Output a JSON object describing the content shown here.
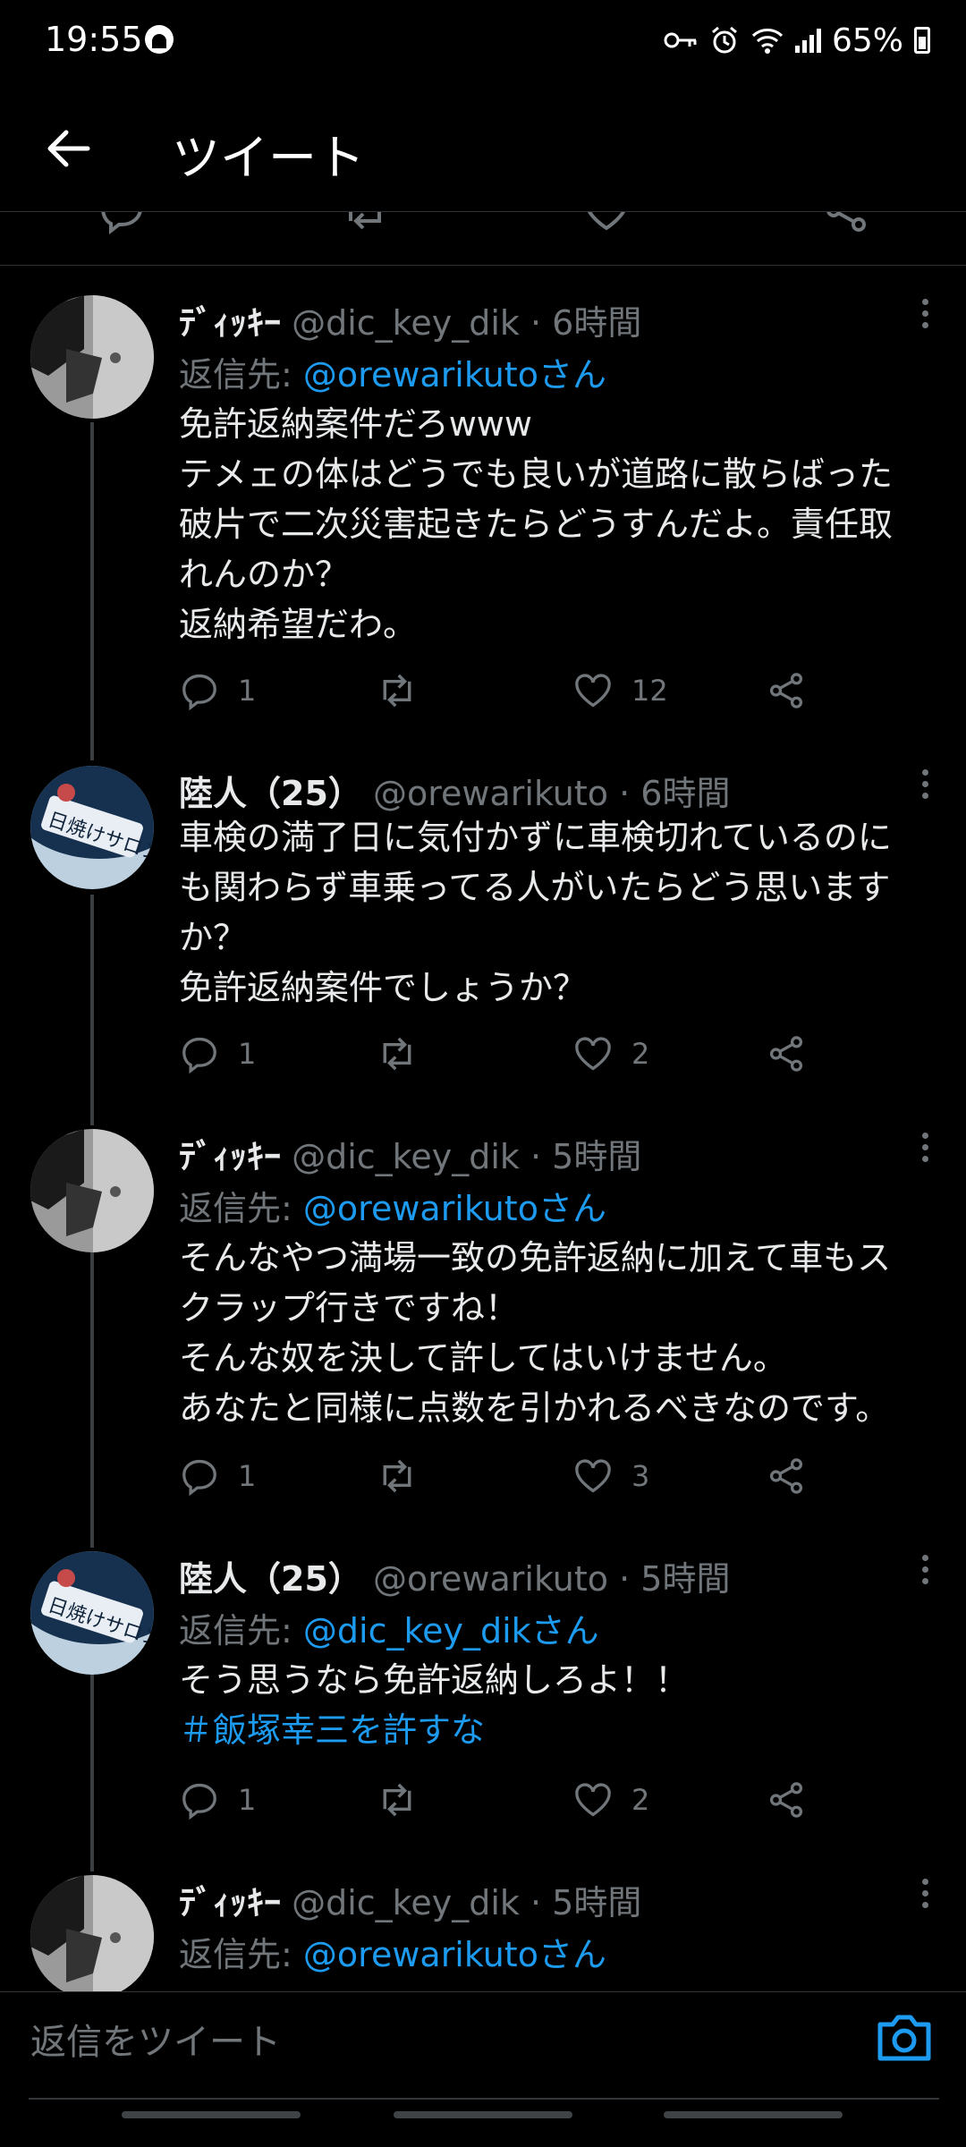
{
  "status_bar": {
    "time": "19:55",
    "battery": "65%"
  },
  "header": {
    "title": "ツイート"
  },
  "tweets": [
    {
      "name": "ﾃﾞｨｯｷｰ",
      "handle": "@dic_key_dik",
      "time": "6時間",
      "reply_label": "返信先:",
      "reply_to": "@orewarikutoさん",
      "text_lines": [
        "免許返納案件だろwww",
        "テメェの体はどうでも良いが道路に散らばった",
        "破片で二次災害起きたらどうすんだよ。責任取",
        "れんのか？",
        "返納希望だわ。"
      ],
      "replies": "1",
      "likes": "12"
    },
    {
      "name": "陸人（25）",
      "handle": "@orewarikuto",
      "time": "6時間",
      "text_lines": [
        "車検の満了日に気付かずに車検切れているのに",
        "も関わらず車乗ってる人がいたらどう思います",
        "か？",
        "免許返納案件でしょうか？"
      ],
      "replies": "1",
      "likes": "2"
    },
    {
      "name": "ﾃﾞｨｯｷｰ",
      "handle": "@dic_key_dik",
      "time": "5時間",
      "reply_label": "返信先:",
      "reply_to": "@orewarikutoさん",
      "text_lines": [
        "そんなやつ満場一致の免許返納に加えて車もス",
        "クラップ行きですね！",
        "そんな奴を決して許してはいけません。",
        "あなたと同様に点数を引かれるべきなのです。"
      ],
      "replies": "1",
      "likes": "3"
    },
    {
      "name": "陸人（25）",
      "handle": "@orewarikuto",
      "time": "5時間",
      "reply_label": "返信先:",
      "reply_to": "@dic_key_dikさん",
      "text_lines": [
        "そう思うなら免許返納しろよ！！"
      ],
      "hashtag": "＃飯塚幸三を許すな",
      "replies": "1",
      "likes": "2"
    },
    {
      "name": "ﾃﾞｨｯｷｰ",
      "handle": "@dic_key_dik",
      "time": "5時間",
      "reply_label": "返信先:",
      "reply_to": "@orewarikutoさん"
    }
  ],
  "composer": {
    "placeholder": "返信をツイート"
  },
  "colors": {
    "background": "#000000",
    "text": "#e7e9ea",
    "muted": "#71767b",
    "accent": "#1d9bf0",
    "divider": "#2f3336"
  },
  "icons": [
    "back-arrow-icon",
    "more-icon",
    "reply-icon",
    "retweet-icon",
    "like-icon",
    "share-icon",
    "camera-icon"
  ]
}
